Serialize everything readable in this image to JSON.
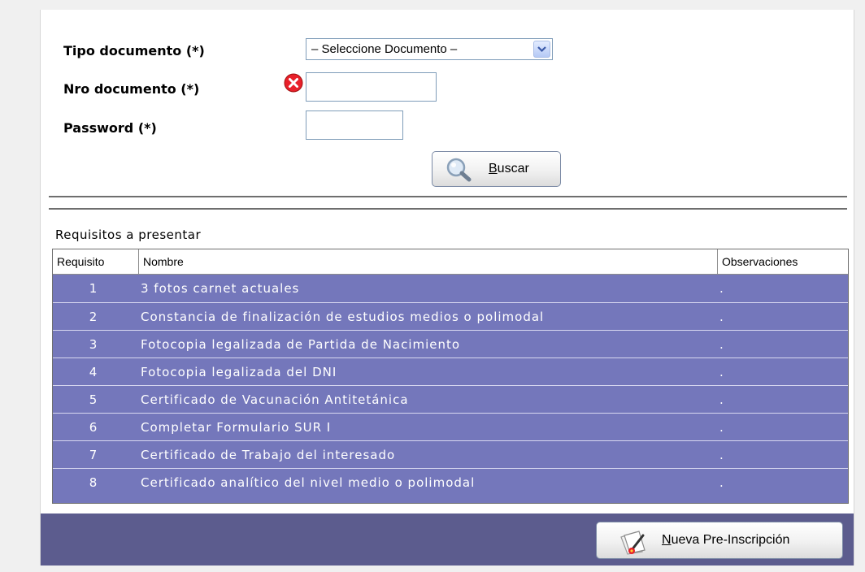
{
  "form": {
    "tipo_label": "Tipo documento (*)",
    "tipo_select_value": "– Seleccione Documento –",
    "nro_label": "Nro documento (*)",
    "nro_value": "",
    "password_label": "Password (*)",
    "password_value": "",
    "buscar_label": "Buscar"
  },
  "grid": {
    "title": "Requisitos a presentar",
    "headers": [
      "Requisito",
      "Nombre",
      "Observaciones"
    ],
    "rows": [
      {
        "num": "1",
        "name": "3 fotos carnet actuales",
        "obs": "."
      },
      {
        "num": "2",
        "name": "Constancia de finalización de estudios medios o polimodal",
        "obs": "."
      },
      {
        "num": "3",
        "name": "Fotocopia legalizada de Partida de Nacimiento",
        "obs": "."
      },
      {
        "num": "4",
        "name": "Fotocopia legalizada del DNI",
        "obs": "."
      },
      {
        "num": "5",
        "name": "Certificado de Vacunación Antitetánica",
        "obs": "."
      },
      {
        "num": "6",
        "name": "Completar Formulario SUR I",
        "obs": "."
      },
      {
        "num": "7",
        "name": "Certificado de Trabajo del interesado",
        "obs": "."
      },
      {
        "num": "8",
        "name": "Certificado analítico del nivel medio o polimodal",
        "obs": "."
      }
    ]
  },
  "footer": {
    "nueva_label": "Nueva Pre-Inscripción"
  },
  "icons": {
    "error": "error-icon",
    "search": "search-icon",
    "document": "document-icon",
    "dropdown": "chevron-down-icon"
  },
  "colors": {
    "row_bg": "#7477bb",
    "footer_bg": "#5c5c8e",
    "error": "#e8202a"
  }
}
